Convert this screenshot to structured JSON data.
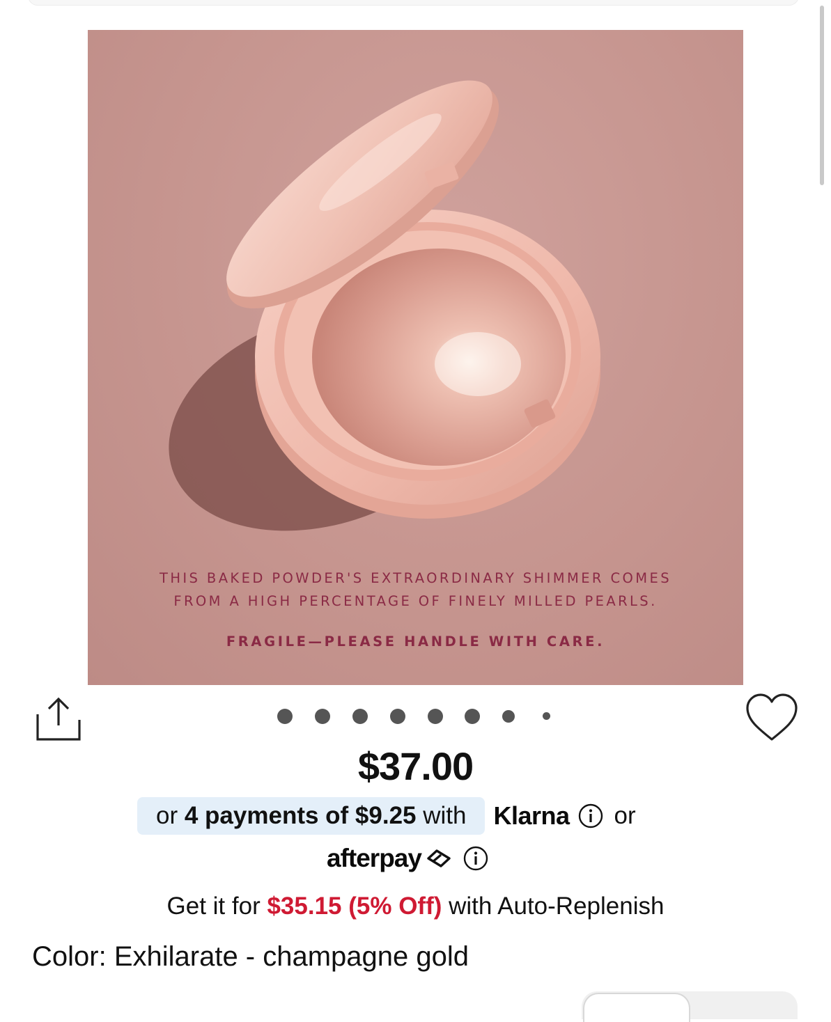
{
  "hero": {
    "caption_line1": "THIS BAKED POWDER'S EXTRAORDINARY SHIMMER COMES",
    "caption_line2": "FROM A HIGH PERCENTAGE OF FINELY MILLED PEARLS.",
    "caption_care": "FRAGILE—PLEASE HANDLE WITH CARE."
  },
  "carousel": {
    "dot_count": 8,
    "active_index": 0
  },
  "icons": {
    "share": "share-icon",
    "favorite": "heart-icon",
    "klarna_info": "info-icon",
    "afterpay_info": "info-icon"
  },
  "price": "$37.00",
  "klarna": {
    "prefix": "or ",
    "bold": "4 payments of $9.25",
    "suffix": " with",
    "brand": "Klarna",
    "trailing": "or"
  },
  "afterpay": {
    "brand": "afterpay"
  },
  "replenish": {
    "prefix": "Get it for ",
    "highlight": "$35.15 (5% Off)",
    "suffix": " with Auto-Replenish"
  },
  "color": {
    "text": "Color: Exhilarate - champagne gold"
  },
  "colors": {
    "hero_bg": "#c6958f",
    "caption": "#8a2a45",
    "klarna_pill": "#e4eff9",
    "sale_red": "#cf1a33"
  }
}
